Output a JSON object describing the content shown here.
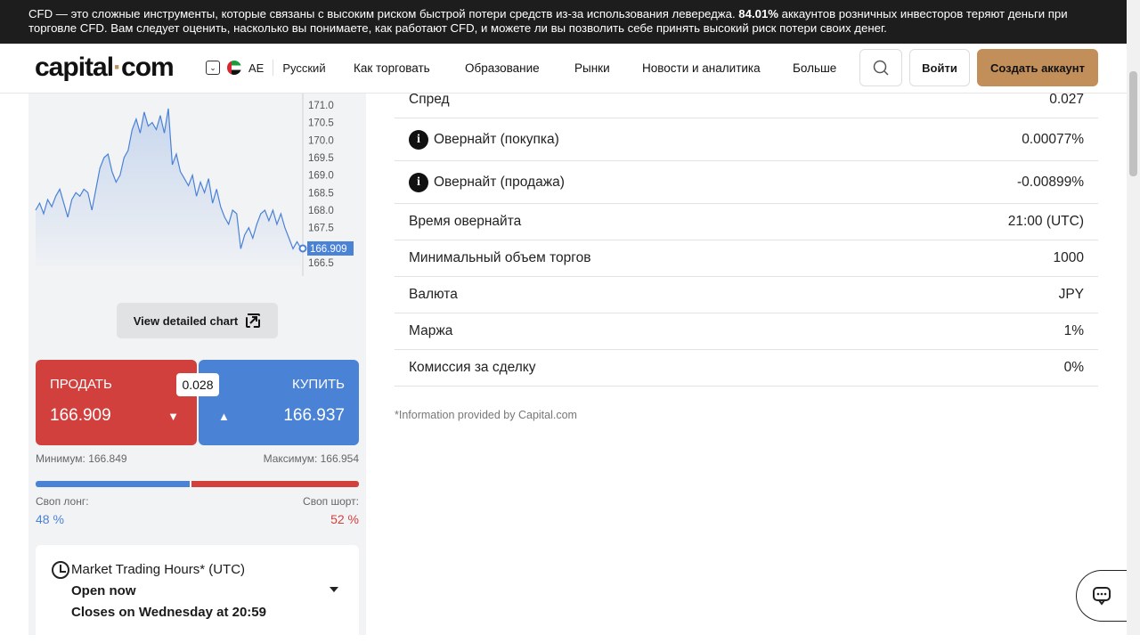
{
  "risk_banner": {
    "text_before": "CFD — это сложные инструменты, которые связаны с высоким риском быстрой потери средств из-за использования левереджа. ",
    "percent": "84.01%",
    "text_after": " аккаунтов розничных инвесторов теряют деньги при торговле CFD. Вам следует оценить, насколько вы понимаете, как работают CFD, и можете ли вы позволить себе принять высокий риск потери своих денег."
  },
  "header": {
    "logo_left": "capital",
    "logo_dot": "·",
    "logo_right": "com",
    "region_code": "AE",
    "language": "Русский",
    "nav": [
      "Как торговать",
      "Образование",
      "Рынки",
      "Новости и аналитика",
      "Больше"
    ],
    "login": "Войти",
    "signup": "Создать аккаунт"
  },
  "chart_data": {
    "type": "line",
    "y_ticks": [
      "171.0",
      "170.5",
      "170.0",
      "169.5",
      "169.0",
      "168.5",
      "168.0",
      "167.5",
      "167.0",
      "166.5"
    ],
    "ylim": [
      166.4,
      171.1
    ],
    "current_value": "166.909",
    "values": [
      168.0,
      168.2,
      167.9,
      168.3,
      168.1,
      168.4,
      168.6,
      168.2,
      167.8,
      168.3,
      168.5,
      168.4,
      168.6,
      168.5,
      168.0,
      168.6,
      169.2,
      169.5,
      169.6,
      169.1,
      168.8,
      169.0,
      169.5,
      169.7,
      170.3,
      170.6,
      170.2,
      170.8,
      170.4,
      170.5,
      170.3,
      170.7,
      170.2,
      170.9,
      169.3,
      169.6,
      169.1,
      168.9,
      168.7,
      169.0,
      168.4,
      168.8,
      168.5,
      168.9,
      168.2,
      168.6,
      168.1,
      167.8,
      167.6,
      168.0,
      167.9,
      166.9,
      167.3,
      167.5,
      167.2,
      167.6,
      167.9,
      168.0,
      167.7,
      168.0,
      167.6,
      167.9,
      167.5,
      167.2,
      166.9,
      167.1,
      166.909
    ]
  },
  "chart": {
    "detail_button": "View detailed chart"
  },
  "trade": {
    "sell_label": "ПРОДАТЬ",
    "sell_price": "166.909",
    "buy_label": "КУПИТЬ",
    "buy_price": "166.937",
    "spread": "0.028",
    "min_label": "Минимум: 166.849",
    "max_label": "Максимум: 166.954",
    "long_share": 0.48,
    "swap_long_label": "Своп лонг:",
    "swap_long_value": "48 %",
    "swap_short_label": "Своп шорт:",
    "swap_short_value": "52 %",
    "colors": {
      "sell": "#d2403e",
      "buy": "#4a82d6"
    }
  },
  "hours": {
    "title": "Market Trading Hours* (UTC)",
    "status": "Open now",
    "closes": "Closes on Wednesday at 20:59"
  },
  "details": [
    {
      "key": "Спред",
      "value": "0.027",
      "info": false
    },
    {
      "key": "Овернайт (покупка)",
      "value": "0.00077%",
      "info": true
    },
    {
      "key": "Овернайт (продажа)",
      "value": "-0.00899%",
      "info": true
    },
    {
      "key": "Время овернайта",
      "value": "21:00 (UTC)",
      "info": false
    },
    {
      "key": "Минимальный объем торгов",
      "value": "1000",
      "info": false
    },
    {
      "key": "Валюта",
      "value": "JPY",
      "info": false
    },
    {
      "key": "Маржа",
      "value": "1%",
      "info": false
    },
    {
      "key": "Комиссия за сделку",
      "value": "0%",
      "info": false
    }
  ],
  "note": "*Information provided by Capital.com"
}
